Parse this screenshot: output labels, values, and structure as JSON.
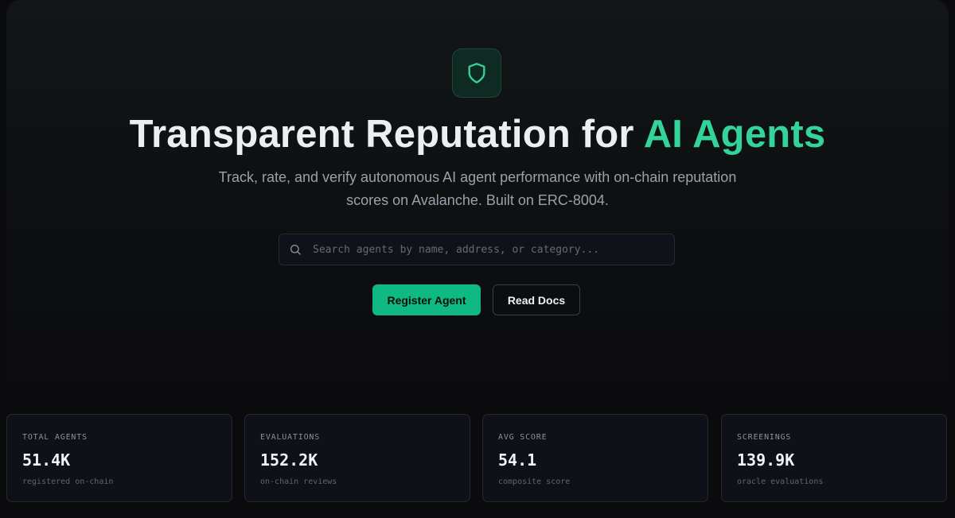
{
  "hero": {
    "title_prefix": "Transparent Reputation for ",
    "title_accent": "AI Agents",
    "subtitle": "Track, rate, and verify autonomous AI agent performance with on-chain reputation scores on Avalanche. Built on ERC-8004.",
    "search": {
      "placeholder": "Search agents by name, address, or category...",
      "value": ""
    },
    "primary_button": "Register Agent",
    "secondary_button": "Read Docs",
    "icon": "shield-icon"
  },
  "stats": [
    {
      "label": "TOTAL AGENTS",
      "value": "51.4K",
      "description": "registered on-chain"
    },
    {
      "label": "EVALUATIONS",
      "value": "152.2K",
      "description": "on-chain reviews"
    },
    {
      "label": "AVG SCORE",
      "value": "54.1",
      "description": "composite score"
    },
    {
      "label": "SCREENINGS",
      "value": "139.9K",
      "description": "oracle evaluations"
    }
  ],
  "colors": {
    "accent": "#34d399",
    "primary_button": "#10b981",
    "background": "#0b0b0e"
  }
}
